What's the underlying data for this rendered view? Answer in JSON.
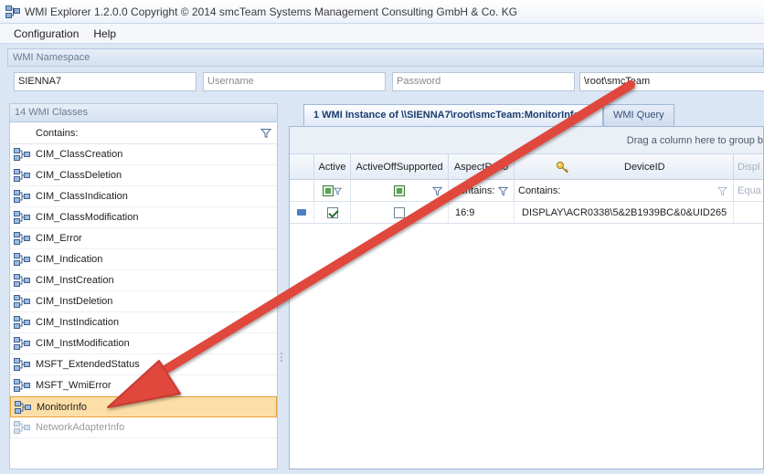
{
  "window": {
    "title": "WMI Explorer 1.2.0.0 Copyright © 2014 smcTeam Systems Management Consulting GmbH & Co. KG"
  },
  "menu": {
    "items": [
      "Configuration",
      "Help"
    ]
  },
  "namespace_panel": {
    "header": "WMI Namespace",
    "computer_value": "SIENNA7",
    "username_placeholder": "Username",
    "password_placeholder": "Password",
    "namespace_value": "\\root\\smcTeam"
  },
  "classes_panel": {
    "header": "14 WMI Classes",
    "filter_label": "Contains:",
    "items": [
      "CIM_ClassCreation",
      "CIM_ClassDeletion",
      "CIM_ClassIndication",
      "CIM_ClassModification",
      "CIM_Error",
      "CIM_Indication",
      "CIM_InstCreation",
      "CIM_InstDeletion",
      "CIM_InstIndication",
      "CIM_InstModification",
      "MSFT_ExtendedStatus",
      "MSFT_WmiError",
      "MonitorInfo",
      "NetworkAdapterInfo"
    ],
    "selected": "MonitorInfo"
  },
  "tabs": {
    "instances": "1 WMI Instance of \\\\SIENNA7\\root\\smcTeam:MonitorInfo",
    "query": "WMI Query"
  },
  "grid": {
    "groupby_hint": "Drag a column here to group b",
    "columns": [
      "Active",
      "ActiveOffSupported",
      "AspectRatio",
      "DeviceID",
      "Displ"
    ],
    "filter": {
      "aspect": "Contains:",
      "device": "Contains:",
      "last": "Equa"
    },
    "row": {
      "active": true,
      "active_off_supported": false,
      "aspect_ratio": "16:9",
      "device_id": "DISPLAY\\ACR0338\\5&2B1939BC&0&UID265"
    }
  },
  "colors": {
    "selection_fill": "#fcdfa8",
    "selection_border": "#e8a23a",
    "arrow": "#e0473c",
    "accent": "#1c3d6e"
  }
}
